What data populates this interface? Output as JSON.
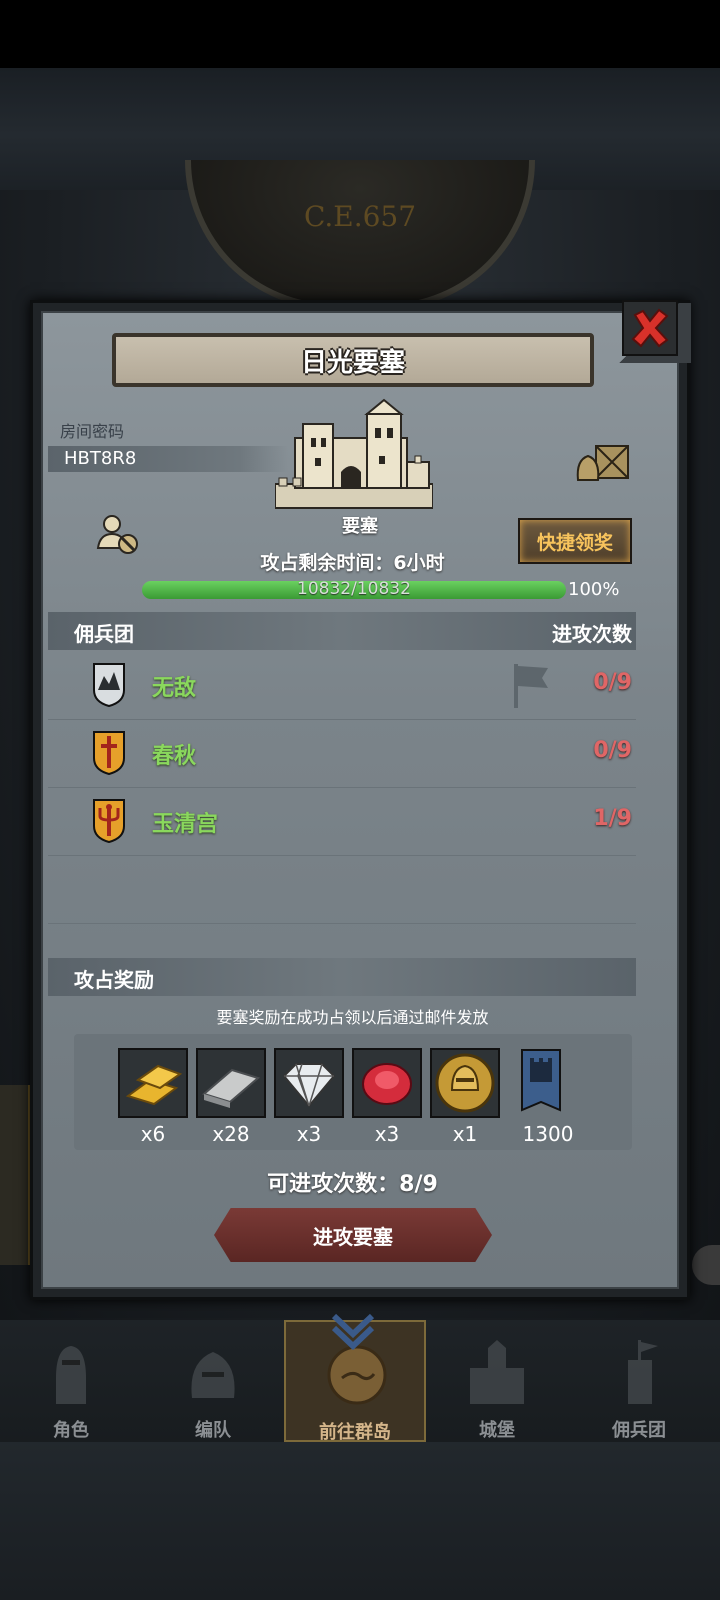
{
  "header": {
    "year": "C.E.657"
  },
  "dialog": {
    "title": "日光要塞",
    "room_password_label": "房间密码",
    "room_code": "HBT8R8",
    "fort_label": "要塞",
    "quick_claim_label": "快捷领奖",
    "time_remaining": "攻占剩余时间：6小时",
    "progress": {
      "text": "10832/10832",
      "percent_label": "100%",
      "value": 1.0
    },
    "mercenary_header": {
      "left": "佣兵团",
      "right": "进攻次数"
    },
    "mercenaries": [
      {
        "name": "无敌",
        "count": "0/9",
        "emblem": "mountain-shield-icon"
      },
      {
        "name": "春秋",
        "count": "0/9",
        "emblem": "sword-shield-icon"
      },
      {
        "name": "玉清宫",
        "count": "1/9",
        "emblem": "trident-shield-icon"
      }
    ],
    "rewards_header": "攻占奖励",
    "reward_note": "要塞奖励在成功占领以后通过邮件发放",
    "rewards": [
      {
        "icon": "gold-bars-icon",
        "qty": "x6"
      },
      {
        "icon": "iron-ingot-icon",
        "qty": "x28"
      },
      {
        "icon": "diamond-icon",
        "qty": "x3"
      },
      {
        "icon": "ruby-icon",
        "qty": "x3"
      },
      {
        "icon": "helmet-coin-icon",
        "qty": "x1"
      },
      {
        "icon": "banner-icon",
        "qty": "1300"
      }
    ],
    "attack_count": "可进攻次数：8/9",
    "attack_button_label": "进攻要塞"
  },
  "nav": {
    "items": [
      {
        "label": "角色"
      },
      {
        "label": "编队"
      },
      {
        "label": "前往群岛",
        "active": true
      },
      {
        "label": "城堡"
      },
      {
        "label": "佣兵团"
      }
    ]
  },
  "colors": {
    "accent_gold": "#f7c35c",
    "mercenary_name": "#8ad85d",
    "attack_count": "#e06666",
    "progress_green": "#3a9a34"
  }
}
